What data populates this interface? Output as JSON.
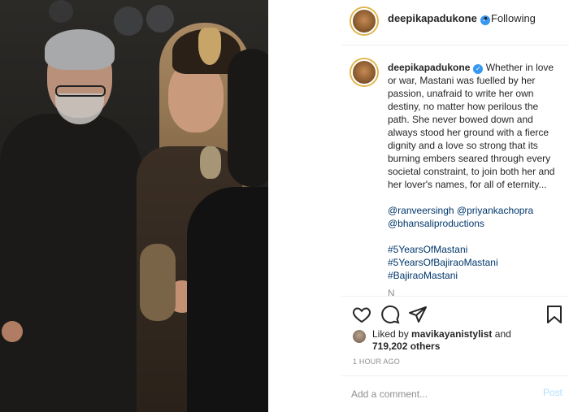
{
  "header": {
    "username": "deepikapadukone",
    "separator": "•",
    "follow_status": "Following"
  },
  "caption": {
    "username": "deepikapadukone",
    "text": "Whether in love or war, Mastani was fuelled by her passion, unafraid to write her own destiny, no matter how perilous the path. She never bowed down and always stood her ground with a fierce dignity and a love so strong that its burning embers seared through every societal constraint, to join both her and her lover's names, for all of eternity...",
    "mentions": [
      "@ranveersingh",
      "@priyankachopra",
      "@bhansaliproductions"
    ],
    "hashtags": [
      "#5YearsOfMastani",
      "#5YearsOfBajiraoMastani",
      "#BajiraoMastani"
    ],
    "more": "N"
  },
  "actions": {
    "icons": [
      "heart-icon",
      "comment-icon",
      "share-icon",
      "bookmark-icon"
    ]
  },
  "likes": {
    "prefix": "Liked by ",
    "user": "mavikayanistylist",
    "joiner": " and ",
    "count": "719,202 others"
  },
  "timestamp": "1 HOUR AGO",
  "comment": {
    "placeholder": "Add a comment...",
    "post_label": "Post"
  },
  "colors": {
    "verified": "#3897f0",
    "link": "#00376b",
    "post_disabled": "#b2dffc",
    "story_ring": "#e1b44a"
  }
}
